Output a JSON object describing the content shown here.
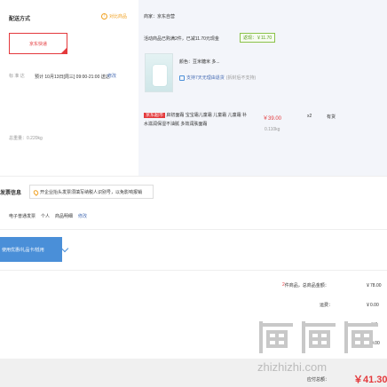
{
  "delivery": {
    "title": "配送方式",
    "compare_label": "对比商品",
    "express_label": "京东快递",
    "time_label": "标 准 达",
    "time_value": "预计 10月13日[周三] 09:00-21:00 送达",
    "modify_label": "修改",
    "weight_label": "总重量：",
    "weight_value": "0.220kg"
  },
  "store": {
    "seller_label": "商家：",
    "seller_name": "京东自营",
    "promo_text": "活动商品已购满2件，已减11.70元现金",
    "promo_tag": "返现：￥11.70"
  },
  "product": {
    "color_label": "颜色：",
    "color_value": "豆米糖米 多...",
    "service_badge": "支持7天无理由退货",
    "service_sub": "(拆封后不支持)",
    "tag": "京东超市",
    "name": "启初面霜 宝宝霜儿童霜 儿童霜 儿童霜 补水滋润保湿不油腻 多效润肤面霜",
    "price": "￥39.00",
    "weight": "0.110kg",
    "qty": "x2",
    "stock": "有货"
  },
  "invoice": {
    "title": "发票信息",
    "notice": "开企业抬头发票须填写纳税人识别号，以免影响报销",
    "type": "电子普通发票",
    "mode": "个人",
    "detail": "商品明细",
    "modify": "修改"
  },
  "gift_card": {
    "label": "使用优惠/礼品卡/抵用",
    "chevron": "chevron-down-icon"
  },
  "summary": {
    "count_prefix": "2",
    "count_label": "件商品，总商品金额：",
    "total_goods": "￥78.00",
    "shipping_label": "运费：",
    "shipping_value": "￥0.00",
    "partial": "-￥1",
    "partial2": "0.00",
    "pay_label": "应付总额：",
    "pay_value": "￥41.30"
  },
  "watermark": {
    "text": "zhizhizhi.com",
    "logo": "值值值"
  },
  "colors": {
    "accent": "#e4393c",
    "link": "#4a6fb5",
    "blue_button": "#4a8fd8",
    "panel_bg": "#f3f5fa"
  }
}
